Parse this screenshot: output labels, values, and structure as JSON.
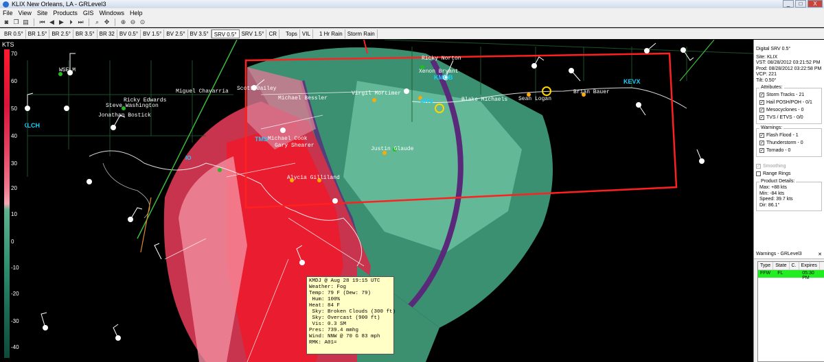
{
  "window": {
    "title": "KLIX New Orleans, LA - GRLevel3",
    "buttons": [
      "_",
      "□",
      "X"
    ]
  },
  "menu": [
    "File",
    "View",
    "Site",
    "Products",
    "GIS",
    "Windows",
    "Help"
  ],
  "toolbar_icons": [
    "open-icon",
    "copy-icon",
    "print-icon",
    "first-frame-icon",
    "prev-frame-icon",
    "play-icon",
    "next-frame-icon",
    "last-frame-icon",
    "zoom-icon",
    "pan-icon",
    "zoom-in-icon",
    "zoom-out-icon",
    "zoom-reset-icon"
  ],
  "products": [
    "BR 0.5°",
    "BR 1.5°",
    "BR 2.5°",
    "BR 3.5°",
    "BR 32",
    "BV 0.5°",
    "BV 1.5°",
    "BV 2.5°",
    "BV 3.5°",
    "SRV 0.5°",
    "SRV 1.5°",
    "CR",
    "Tops",
    "VIL",
    "1 Hr Rain",
    "Storm Rain"
  ],
  "active_product": "SRV 0.5°",
  "colorbar": {
    "title": "KTS",
    "ticks": [
      "70",
      "60",
      "50",
      "40",
      "30",
      "20",
      "10",
      "0",
      "-10",
      "-20",
      "-30",
      "-40"
    ]
  },
  "info": {
    "product": "Digital SRV 0.5°",
    "site": "Site: KLIX",
    "vst": "VST: 08/28/2012 03:21:52 PM",
    "prod": "Prod: 08/28/2012 03:22:58 PM",
    "vcp": "VCP: 221",
    "tilt": "Tilt: 0.50°"
  },
  "attributes": {
    "title": "Attributes:",
    "items": [
      "Storm Tracks - 21",
      "Hail POSH/POH - 0/1",
      "Mesocyclones - 0",
      "TVS / ETVS - 0/0"
    ]
  },
  "warnings_group": {
    "title": "Warnings:",
    "items": [
      "Flash Flood - 1",
      "Thunderstorm - 0",
      "Tornado - 0"
    ]
  },
  "smoothing": "Smoothing",
  "range_rings": "Range Rings",
  "product_details": {
    "title": "Product Details:",
    "max": "Max: +88 kts",
    "min": "Min: -84 kts",
    "speed": "Speed: 39.7 kts",
    "dir": "Dir: 86.1°"
  },
  "warnings_window": {
    "title": "Warnings - GRLevel3",
    "columns": [
      "Type",
      "State",
      "C.",
      "Expires"
    ],
    "rows": [
      {
        "type": "FFW",
        "state": "FL",
        "c": "",
        "expires": "05:30 PM"
      }
    ]
  },
  "stations": [
    "Ricky Norton",
    "Xenon Bryant",
    "KMOB",
    "Blake Michaels",
    "Sean Logan",
    "Brian Bauer",
    "Scott Bailey",
    "Michael Bessler",
    "Virgil Mortimer",
    "SRG",
    "Ricky Edwards",
    "Steve Washington",
    "Jonathan Bostick",
    "Miguel Chavarria",
    "WSELM",
    "Justin Glaude",
    "Alycia Gilliland",
    "Michael Cook",
    "Gary Shearer",
    "KLCH",
    "KEVX",
    "TMS",
    "IO"
  ],
  "popup": {
    "lines": [
      "KMDJ @ Aug 28 19:15 UTC",
      "Weather: Fog",
      "Temp: 79 F (Dew: 79)",
      " Hum: 100%",
      "Heat: 84 F",
      " Sky: Broken Clouds (300 ft)",
      " Sky: Overcast (900 ft)",
      " Vis: 0.3 SM",
      "Pres: 739.4 mmhg",
      "Wind: NNW @ 70 G 83 mph",
      "RMK: A01="
    ]
  },
  "colors": {
    "warning_box": "#ff2020",
    "inbound": "#3aa07a",
    "outbound": "#e01835",
    "station_dot": "#22bb22",
    "ffw_row": "#22ee22"
  }
}
